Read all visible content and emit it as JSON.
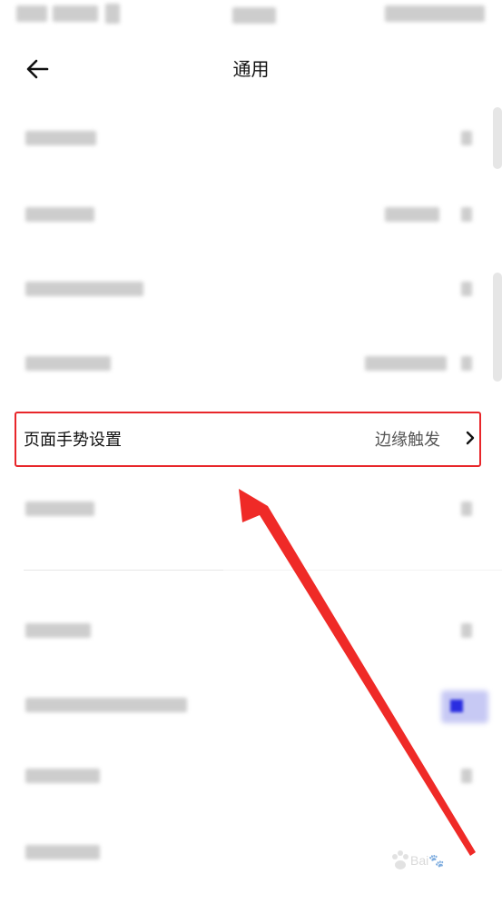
{
  "header": {
    "title": "通用"
  },
  "gesture_row": {
    "label": "页面手势设置",
    "value": "边缘触发"
  },
  "colors": {
    "highlight": "#e8262a",
    "arrow": "#ef2a27",
    "text_primary": "#111111",
    "text_secondary": "#555555"
  },
  "icons": {
    "back": "arrow-left-icon",
    "chevron": "chevron-right-icon"
  }
}
